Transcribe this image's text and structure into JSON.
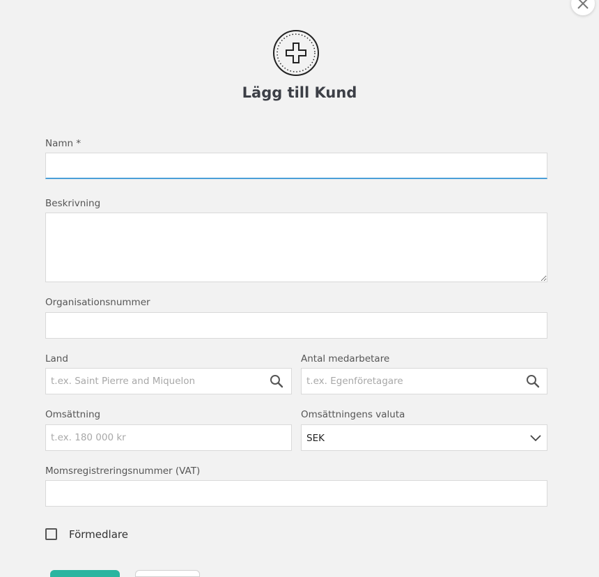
{
  "modal": {
    "title": "Lägg till Kund",
    "header_icon": "plus-circle-icon",
    "close_icon": "close-icon"
  },
  "form": {
    "name": {
      "label": "Namn *",
      "value": "",
      "placeholder": ""
    },
    "description": {
      "label": "Beskrivning",
      "value": "",
      "placeholder": ""
    },
    "org_number": {
      "label": "Organisationsnummer",
      "value": "",
      "placeholder": ""
    },
    "country": {
      "label": "Land",
      "placeholder": "t.ex. Saint Pierre and Miquelon",
      "icon": "search-icon"
    },
    "employees": {
      "label": "Antal medarbetare",
      "placeholder": "t.ex. Egenföretagare",
      "icon": "search-icon"
    },
    "revenue": {
      "label": "Omsättning",
      "placeholder": "t.ex. 180 000 kr"
    },
    "currency": {
      "label": "Omsättningens valuta",
      "value": "SEK",
      "icon": "chevron-down-icon"
    },
    "vat": {
      "label": "Momsregistreringsnummer (VAT)",
      "value": "",
      "placeholder": ""
    },
    "intermediary": {
      "label": "Förmedlare",
      "checked": false
    }
  },
  "colors": {
    "background": "#f2f2f2",
    "focus": "#4a9fd8",
    "primary": "#2bb5a0"
  }
}
